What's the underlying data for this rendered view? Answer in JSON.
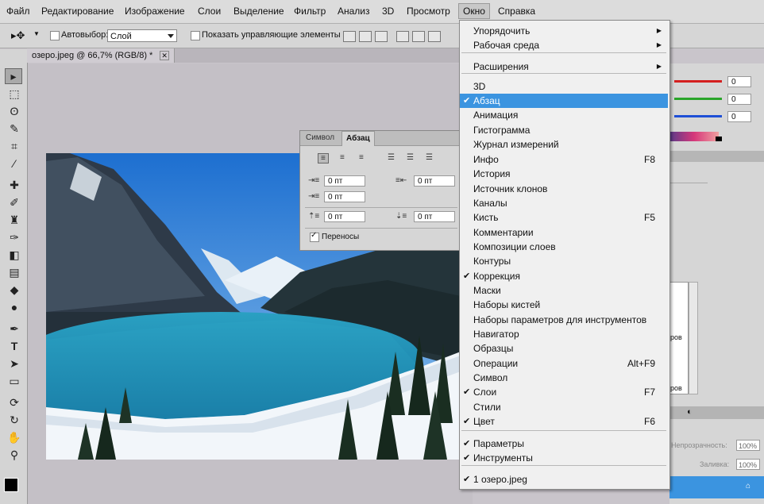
{
  "menubar": {
    "items": [
      "Файл",
      "Редактирование",
      "Изображение",
      "Слои",
      "Выделение",
      "Фильтр",
      "Анализ",
      "3D",
      "Просмотр",
      "Окно",
      "Справка"
    ]
  },
  "options": {
    "autoselect_label": "Автовыбор:",
    "autoselect_value": "Слой",
    "show_controls_label": "Показать управляющие элементы"
  },
  "document": {
    "tab_title": "озеро.jpeg @ 66,7% (RGB/8) *",
    "close_glyph": "✕"
  },
  "paragraph_panel": {
    "tab_symbol": "Символ",
    "tab_paragraph": "Абзац",
    "indent_left": "0 пт",
    "indent_right": "0 пт",
    "indent_first": "0 пт",
    "space_before": "0 пт",
    "space_after": "0 пт",
    "hyphenate_label": "Переносы"
  },
  "color_panel": {
    "r": "0",
    "g": "0",
    "b": "0",
    "colors": {
      "red": "#d42020",
      "green": "#2aa52a",
      "blue": "#1e4fd6"
    }
  },
  "layers_panel": {
    "list_rows": [
      "ров",
      "ров"
    ],
    "opacity_label": "Непрозрачность:",
    "opacity_value": "100%",
    "fill_label": "Заливка:",
    "fill_value": "100%"
  },
  "window_menu": {
    "items": [
      {
        "label": "Упорядочить",
        "submenu": true
      },
      {
        "label": "Рабочая среда",
        "submenu": true
      },
      {
        "label": "Расширения",
        "submenu": true
      },
      {
        "label": "3D"
      },
      {
        "label": "Абзац",
        "checked": true,
        "highlighted": true
      },
      {
        "label": "Анимация"
      },
      {
        "label": "Гистограмма"
      },
      {
        "label": "Журнал измерений"
      },
      {
        "label": "Инфо",
        "shortcut": "F8"
      },
      {
        "label": "История"
      },
      {
        "label": "Источник клонов"
      },
      {
        "label": "Каналы"
      },
      {
        "label": "Кисть",
        "shortcut": "F5"
      },
      {
        "label": "Комментарии"
      },
      {
        "label": "Композиции слоев"
      },
      {
        "label": "Контуры"
      },
      {
        "label": "Коррекция",
        "checked": true
      },
      {
        "label": "Маски"
      },
      {
        "label": "Наборы кистей"
      },
      {
        "label": "Наборы параметров для инструментов"
      },
      {
        "label": "Навигатор"
      },
      {
        "label": "Образцы"
      },
      {
        "label": "Операции",
        "shortcut": "Alt+F9"
      },
      {
        "label": "Символ"
      },
      {
        "label": "Слои",
        "checked": true,
        "shortcut": "F7"
      },
      {
        "label": "Стили"
      },
      {
        "label": "Цвет",
        "checked": true,
        "shortcut": "F6"
      },
      {
        "label": "Параметры",
        "checked": true
      },
      {
        "label": "Инструменты",
        "checked": true
      },
      {
        "label": "1 озеро.jpeg",
        "checked": true
      }
    ],
    "check_glyph": "✔",
    "submenu_glyph": "▶"
  },
  "accent": "#3b94e0"
}
